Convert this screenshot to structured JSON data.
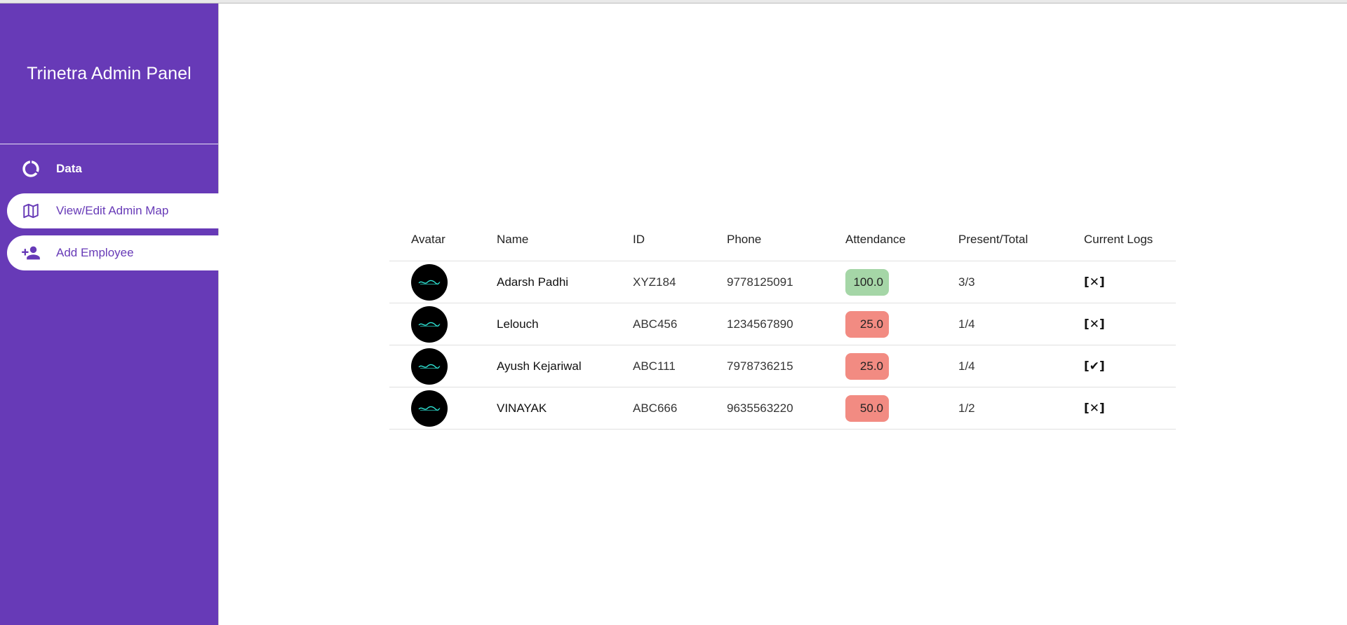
{
  "sidebar": {
    "title": "Trinetra Admin Panel",
    "items": [
      {
        "label": "Data",
        "icon": "donut-chart-icon"
      },
      {
        "label": "View/Edit Admin Map",
        "icon": "map-icon"
      },
      {
        "label": "Add Employee",
        "icon": "person-add-icon"
      }
    ]
  },
  "table": {
    "headers": {
      "avatar": "Avatar",
      "name": "Name",
      "id": "ID",
      "phone": "Phone",
      "attendance": "Attendance",
      "present_total": "Present/Total",
      "logs": "Current Logs"
    },
    "rows": [
      {
        "name": "Adarsh Padhi",
        "id": "XYZ184",
        "phone": "9778125091",
        "attendance": "100.0",
        "present_total": "3/3",
        "logs": "[✕]",
        "badge_color": "#a5d6a7"
      },
      {
        "name": "Lelouch",
        "id": "ABC456",
        "phone": "1234567890",
        "attendance": "25.0",
        "present_total": "1/4",
        "logs": "[✕]",
        "badge_color": "#f28b82"
      },
      {
        "name": "Ayush Kejariwal",
        "id": "ABC111",
        "phone": "7978736215",
        "attendance": "25.0",
        "present_total": "1/4",
        "logs": "[✔]",
        "badge_color": "#f28b82"
      },
      {
        "name": "VINAYAK",
        "id": "ABC666",
        "phone": "9635563220",
        "attendance": "50.0",
        "present_total": "1/2",
        "logs": "[✕]",
        "badge_color": "#f28b82"
      }
    ]
  },
  "colors": {
    "sidebar_bg": "#673ab7",
    "good": "#a5d6a7",
    "bad": "#f28b82"
  }
}
